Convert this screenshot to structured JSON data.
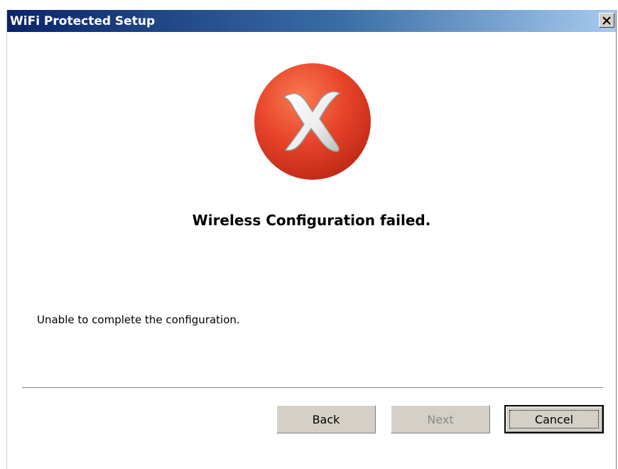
{
  "window": {
    "title": "WiFi Protected Setup",
    "close_glyph": "✕"
  },
  "status": {
    "icon": "error-x-icon",
    "icon_color": "#e8442a",
    "headline": "Wireless Configuration failed.",
    "message": "Unable to complete the configuration."
  },
  "buttons": {
    "back": "Back",
    "next": "Next",
    "cancel": "Cancel"
  },
  "colors": {
    "titlebar_start": "#0a246a",
    "titlebar_end": "#a6caf0",
    "button_face": "#d4d0c8",
    "disabled_text": "#8a8a8a"
  }
}
